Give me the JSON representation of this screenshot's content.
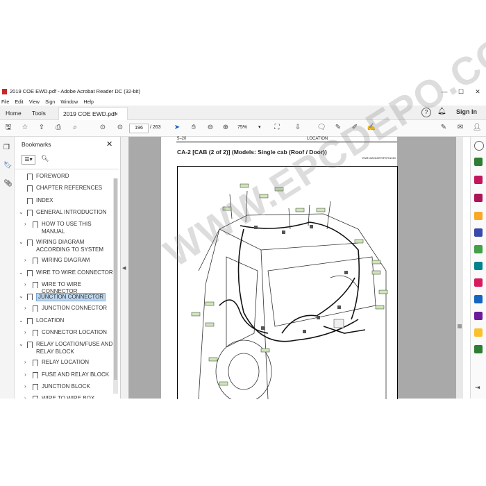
{
  "window": {
    "title": "2019 COE EWD.pdf - Adobe Acrobat Reader DC (32-bit)",
    "min": "—",
    "max": "☐",
    "close": "✕"
  },
  "menu": [
    "File",
    "Edit",
    "View",
    "Sign",
    "Window",
    "Help"
  ],
  "tabs": {
    "home": "Home",
    "tools": "Tools",
    "doc": "2019 COE EWD.pdf",
    "close": "×",
    "signin": "Sign In"
  },
  "toolbar": {
    "page_current": "196",
    "page_total": "/ 263",
    "zoom": "75%"
  },
  "bookmarks": {
    "title": "Bookmarks",
    "items": [
      {
        "label": "FOREWORD",
        "level": 0,
        "arrow": ""
      },
      {
        "label": "CHAPTER REFERENCES",
        "level": 0,
        "arrow": ""
      },
      {
        "label": "INDEX",
        "level": 0,
        "arrow": ""
      },
      {
        "label": "GENERAL INTRODUCTION",
        "level": 0,
        "arrow": "⌄"
      },
      {
        "label": "HOW TO USE THIS",
        "label2": "MANUAL",
        "level": 1,
        "arrow": "›"
      },
      {
        "label": "WIRING DIAGRAM",
        "label2": "ACCORDING TO SYSTEM",
        "level": 0,
        "arrow": "⌄"
      },
      {
        "label": "WIRING DIAGRAM",
        "level": 1,
        "arrow": "›"
      },
      {
        "label": "WIRE TO WIRE CONNECTOR",
        "level": 0,
        "arrow": "⌄"
      },
      {
        "label": "WIRE TO WIRE CONNECTOR",
        "level": 1,
        "arrow": "›"
      },
      {
        "label": "JUNCTION CONNECTOR",
        "level": 0,
        "arrow": "⌄",
        "selected": true
      },
      {
        "label": "JUNCTION CONNECTOR",
        "level": 1,
        "arrow": "›"
      },
      {
        "label": "LOCATION",
        "level": 0,
        "arrow": "⌄"
      },
      {
        "label": "CONNECTOR LOCATION",
        "level": 1,
        "arrow": "›"
      },
      {
        "label": "RELAY LOCATION/FUSE AND",
        "label2": "RELAY BLOCK",
        "level": 0,
        "arrow": "⌄"
      },
      {
        "label": "RELAY LOCATION",
        "level": 1,
        "arrow": "›"
      },
      {
        "label": "FUSE AND RELAY BLOCK",
        "level": 1,
        "arrow": "›"
      },
      {
        "label": "JUNCTION BLOCK",
        "level": 1,
        "arrow": "›"
      },
      {
        "label": "WIRE TO WIRE BOX",
        "level": 1,
        "arrow": "›"
      }
    ]
  },
  "document": {
    "page_no": "5–20",
    "section": "LOCATION",
    "heading": "CA-2 [CAB (2 of 2)] (Models: Single cab (Roof / Door))",
    "code": "ENR10ZZZZZF0F0F01010",
    "watermark": "WWW.EPCDEPO.COM"
  }
}
